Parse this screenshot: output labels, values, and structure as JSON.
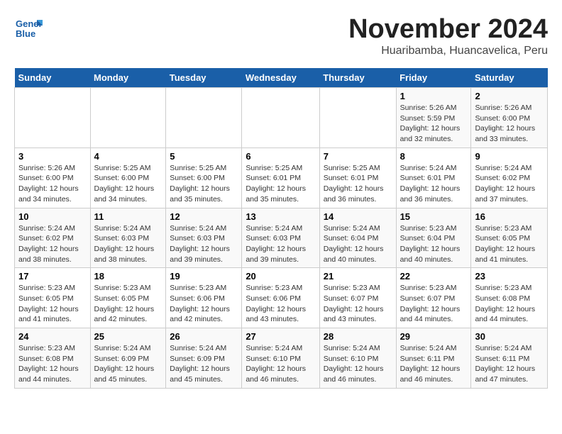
{
  "logo": {
    "line1": "General",
    "line2": "Blue"
  },
  "title": "November 2024",
  "subtitle": "Huaribamba, Huancavelica, Peru",
  "days_of_week": [
    "Sunday",
    "Monday",
    "Tuesday",
    "Wednesday",
    "Thursday",
    "Friday",
    "Saturday"
  ],
  "weeks": [
    [
      {
        "day": "",
        "info": ""
      },
      {
        "day": "",
        "info": ""
      },
      {
        "day": "",
        "info": ""
      },
      {
        "day": "",
        "info": ""
      },
      {
        "day": "",
        "info": ""
      },
      {
        "day": "1",
        "info": "Sunrise: 5:26 AM\nSunset: 5:59 PM\nDaylight: 12 hours and 32 minutes."
      },
      {
        "day": "2",
        "info": "Sunrise: 5:26 AM\nSunset: 6:00 PM\nDaylight: 12 hours and 33 minutes."
      }
    ],
    [
      {
        "day": "3",
        "info": "Sunrise: 5:26 AM\nSunset: 6:00 PM\nDaylight: 12 hours and 34 minutes."
      },
      {
        "day": "4",
        "info": "Sunrise: 5:25 AM\nSunset: 6:00 PM\nDaylight: 12 hours and 34 minutes."
      },
      {
        "day": "5",
        "info": "Sunrise: 5:25 AM\nSunset: 6:00 PM\nDaylight: 12 hours and 35 minutes."
      },
      {
        "day": "6",
        "info": "Sunrise: 5:25 AM\nSunset: 6:01 PM\nDaylight: 12 hours and 35 minutes."
      },
      {
        "day": "7",
        "info": "Sunrise: 5:25 AM\nSunset: 6:01 PM\nDaylight: 12 hours and 36 minutes."
      },
      {
        "day": "8",
        "info": "Sunrise: 5:24 AM\nSunset: 6:01 PM\nDaylight: 12 hours and 36 minutes."
      },
      {
        "day": "9",
        "info": "Sunrise: 5:24 AM\nSunset: 6:02 PM\nDaylight: 12 hours and 37 minutes."
      }
    ],
    [
      {
        "day": "10",
        "info": "Sunrise: 5:24 AM\nSunset: 6:02 PM\nDaylight: 12 hours and 38 minutes."
      },
      {
        "day": "11",
        "info": "Sunrise: 5:24 AM\nSunset: 6:03 PM\nDaylight: 12 hours and 38 minutes."
      },
      {
        "day": "12",
        "info": "Sunrise: 5:24 AM\nSunset: 6:03 PM\nDaylight: 12 hours and 39 minutes."
      },
      {
        "day": "13",
        "info": "Sunrise: 5:24 AM\nSunset: 6:03 PM\nDaylight: 12 hours and 39 minutes."
      },
      {
        "day": "14",
        "info": "Sunrise: 5:24 AM\nSunset: 6:04 PM\nDaylight: 12 hours and 40 minutes."
      },
      {
        "day": "15",
        "info": "Sunrise: 5:23 AM\nSunset: 6:04 PM\nDaylight: 12 hours and 40 minutes."
      },
      {
        "day": "16",
        "info": "Sunrise: 5:23 AM\nSunset: 6:05 PM\nDaylight: 12 hours and 41 minutes."
      }
    ],
    [
      {
        "day": "17",
        "info": "Sunrise: 5:23 AM\nSunset: 6:05 PM\nDaylight: 12 hours and 41 minutes."
      },
      {
        "day": "18",
        "info": "Sunrise: 5:23 AM\nSunset: 6:05 PM\nDaylight: 12 hours and 42 minutes."
      },
      {
        "day": "19",
        "info": "Sunrise: 5:23 AM\nSunset: 6:06 PM\nDaylight: 12 hours and 42 minutes."
      },
      {
        "day": "20",
        "info": "Sunrise: 5:23 AM\nSunset: 6:06 PM\nDaylight: 12 hours and 43 minutes."
      },
      {
        "day": "21",
        "info": "Sunrise: 5:23 AM\nSunset: 6:07 PM\nDaylight: 12 hours and 43 minutes."
      },
      {
        "day": "22",
        "info": "Sunrise: 5:23 AM\nSunset: 6:07 PM\nDaylight: 12 hours and 44 minutes."
      },
      {
        "day": "23",
        "info": "Sunrise: 5:23 AM\nSunset: 6:08 PM\nDaylight: 12 hours and 44 minutes."
      }
    ],
    [
      {
        "day": "24",
        "info": "Sunrise: 5:23 AM\nSunset: 6:08 PM\nDaylight: 12 hours and 44 minutes."
      },
      {
        "day": "25",
        "info": "Sunrise: 5:24 AM\nSunset: 6:09 PM\nDaylight: 12 hours and 45 minutes."
      },
      {
        "day": "26",
        "info": "Sunrise: 5:24 AM\nSunset: 6:09 PM\nDaylight: 12 hours and 45 minutes."
      },
      {
        "day": "27",
        "info": "Sunrise: 5:24 AM\nSunset: 6:10 PM\nDaylight: 12 hours and 46 minutes."
      },
      {
        "day": "28",
        "info": "Sunrise: 5:24 AM\nSunset: 6:10 PM\nDaylight: 12 hours and 46 minutes."
      },
      {
        "day": "29",
        "info": "Sunrise: 5:24 AM\nSunset: 6:11 PM\nDaylight: 12 hours and 46 minutes."
      },
      {
        "day": "30",
        "info": "Sunrise: 5:24 AM\nSunset: 6:11 PM\nDaylight: 12 hours and 47 minutes."
      }
    ]
  ]
}
